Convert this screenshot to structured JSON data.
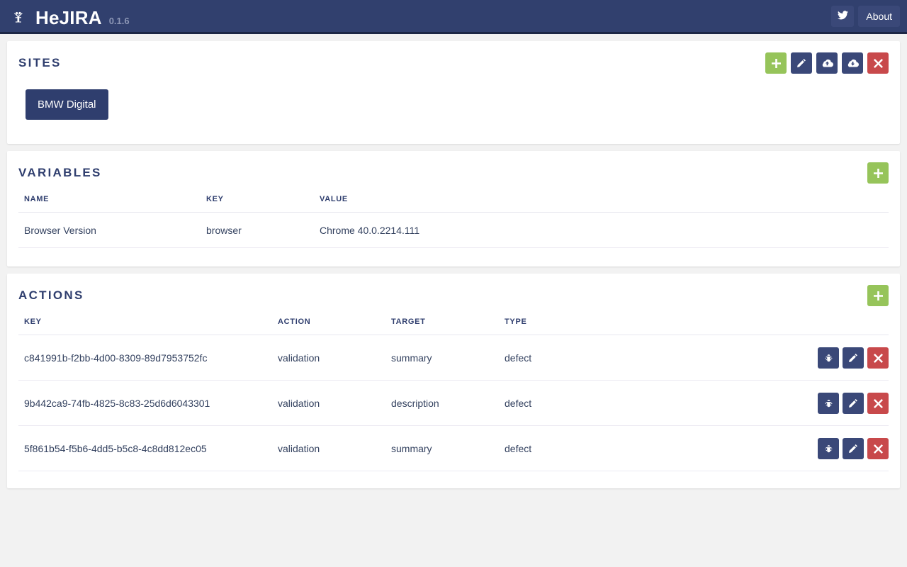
{
  "navbar": {
    "brand_icon": "hejira-logo-icon",
    "brand_name": "HeJIRA",
    "version": "0.1.6",
    "twitter_label": "twitter-icon",
    "about_label": "About",
    "bg_color": "#31406e"
  },
  "sites": {
    "title": "SITES",
    "tools": [
      {
        "name": "add-site-button",
        "icon": "plus-icon",
        "color": "#96c45a"
      },
      {
        "name": "edit-site-button",
        "icon": "pencil-icon",
        "color": "#3a4878"
      },
      {
        "name": "upload-site-button",
        "icon": "cloud-upload-icon",
        "color": "#3a4878"
      },
      {
        "name": "download-site-button",
        "icon": "cloud-download-icon",
        "color": "#3a4878"
      },
      {
        "name": "delete-site-button",
        "icon": "close-x-icon",
        "color": "#c8494b"
      }
    ],
    "items": [
      {
        "label": "BMW Digital",
        "selected": true
      }
    ]
  },
  "variables": {
    "title": "VARIABLES",
    "add_label": "plus-icon",
    "columns": [
      "NAME",
      "KEY",
      "VALUE"
    ],
    "rows": [
      {
        "name": "Browser Version",
        "key": "browser",
        "value": "Chrome 40.0.2214.111"
      }
    ]
  },
  "actions": {
    "title": "ACTIONS",
    "add_label": "plus-icon",
    "columns": [
      "KEY",
      "ACTION",
      "TARGET",
      "TYPE"
    ],
    "rows": [
      {
        "key": "c841991b-f2bb-4d00-8309-89d7953752fc",
        "action": "validation",
        "target": "summary",
        "type": "defect"
      },
      {
        "key": "9b442ca9-74fb-4825-8c83-25d6d6043301",
        "action": "validation",
        "target": "description",
        "type": "defect"
      },
      {
        "key": "5f861b54-f5b6-4dd5-b5c8-4c8dd812ec05",
        "action": "validation",
        "target": "summary",
        "type": "defect"
      }
    ],
    "row_tools": [
      {
        "name": "bug-button",
        "icon": "bug-icon",
        "color": "#3a4878"
      },
      {
        "name": "edit-action-button",
        "icon": "pencil-icon",
        "color": "#3a4878"
      },
      {
        "name": "delete-action-button",
        "icon": "close-x-icon",
        "color": "#c8494b"
      }
    ]
  },
  "colors": {
    "navy": "#2f3e6e",
    "navy_button": "#3a4878",
    "green": "#96c45a",
    "red": "#c8494b",
    "page_bg": "#f2f2f2"
  }
}
